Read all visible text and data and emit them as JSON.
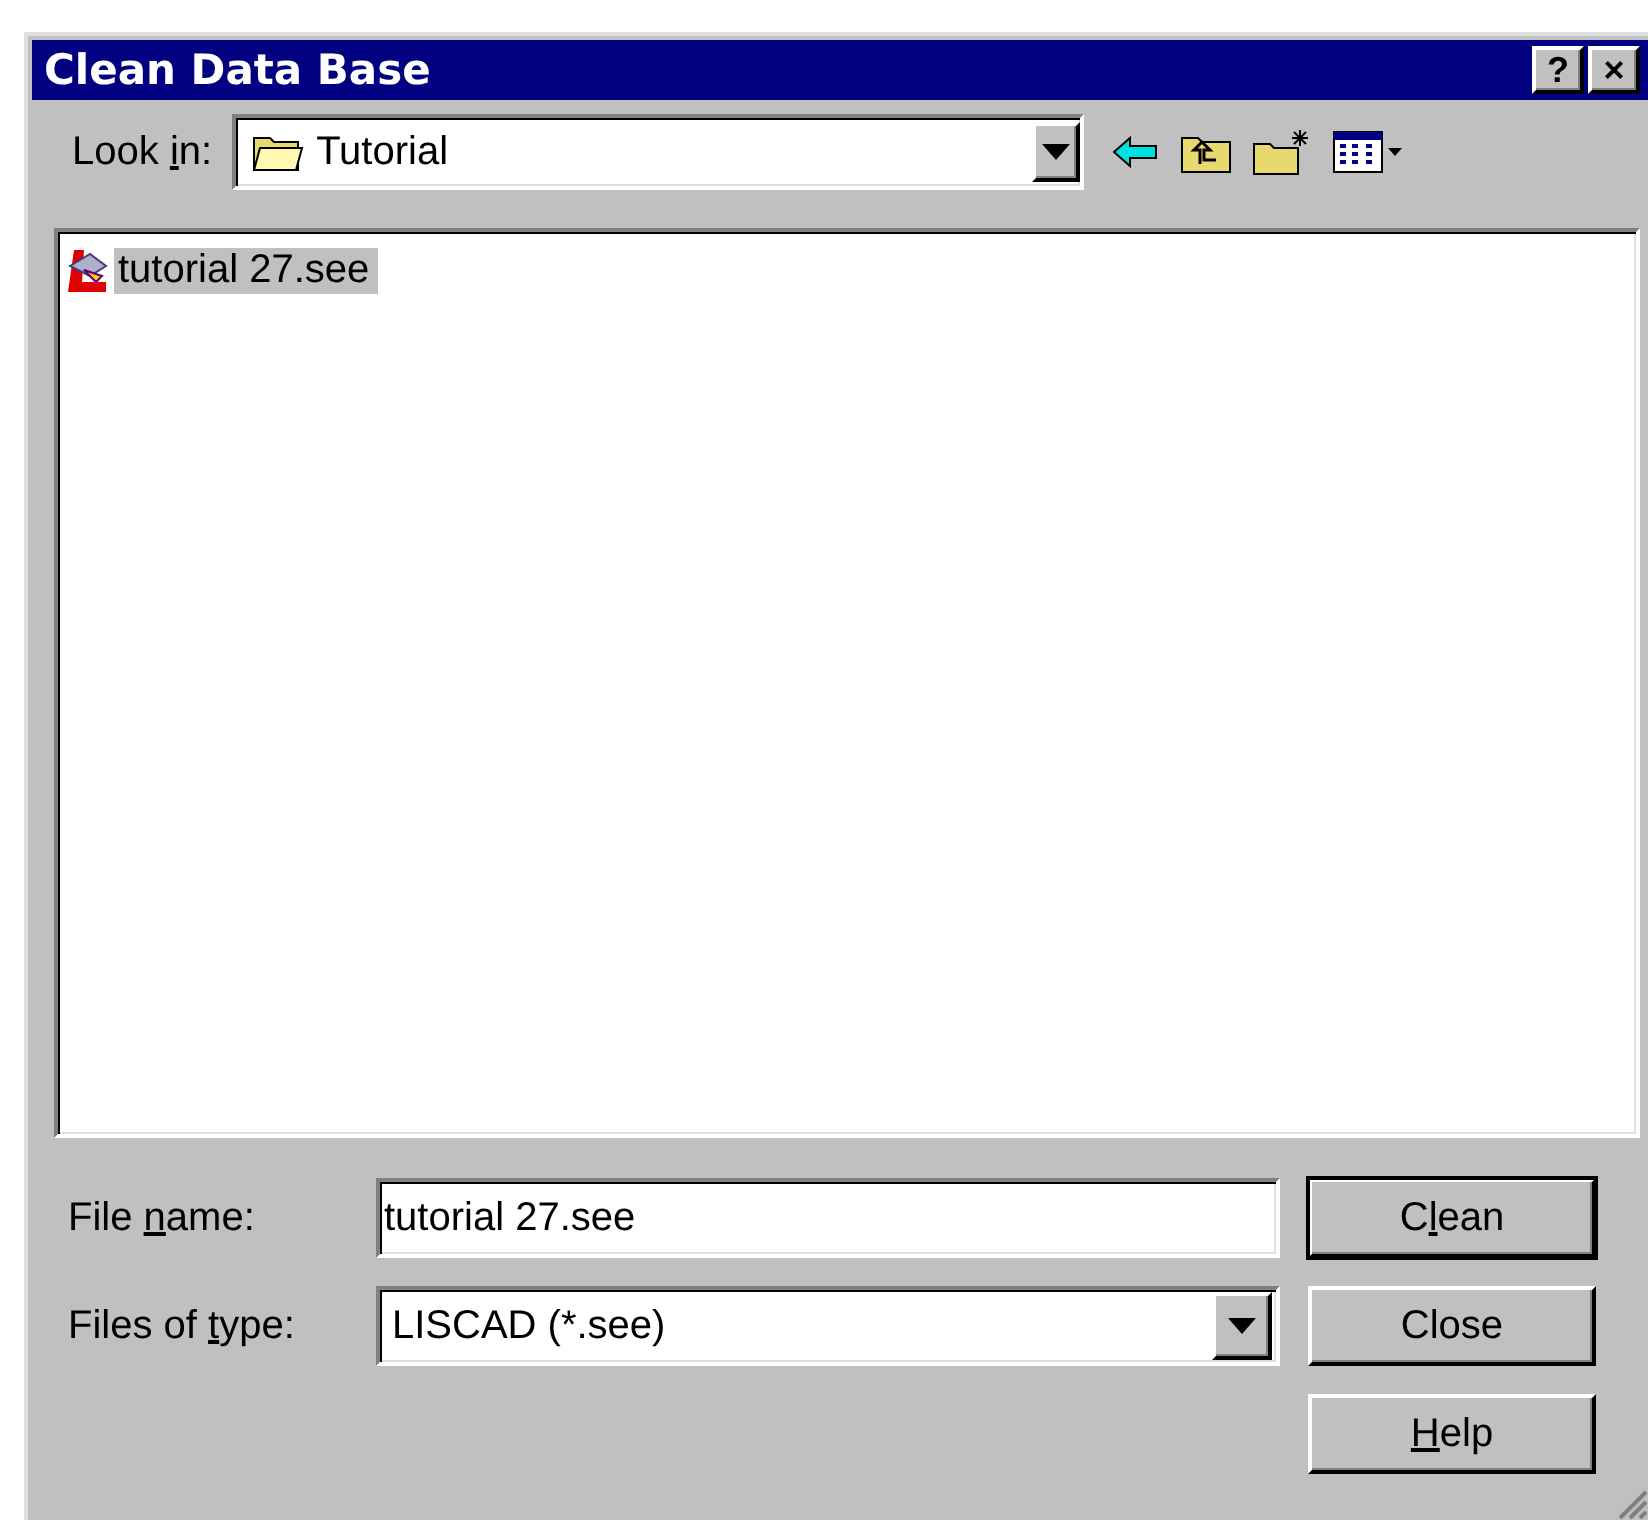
{
  "window": {
    "title": "Clean Data Base",
    "title_buttons": [
      "?",
      "×"
    ]
  },
  "look_in": {
    "label": {
      "before": "Look ",
      "key": "i",
      "after": "n:"
    },
    "value": "Tutorial"
  },
  "files": [
    {
      "name": "tutorial 27.see",
      "selected": true
    }
  ],
  "file_name": {
    "label": {
      "before": "File ",
      "key": "n",
      "after": "ame:"
    },
    "value": "tutorial 27.see"
  },
  "file_type": {
    "label": {
      "before": "Files of ",
      "key": "t",
      "after": "ype:"
    },
    "value": "LISCAD (*.see)"
  },
  "buttons": [
    {
      "label": {
        "before": "C",
        "key": "l",
        "after": "ean"
      },
      "default": true
    },
    {
      "label": "Close",
      "default": false
    },
    {
      "label": {
        "key": "H",
        "after": "elp"
      },
      "default": false
    }
  ]
}
